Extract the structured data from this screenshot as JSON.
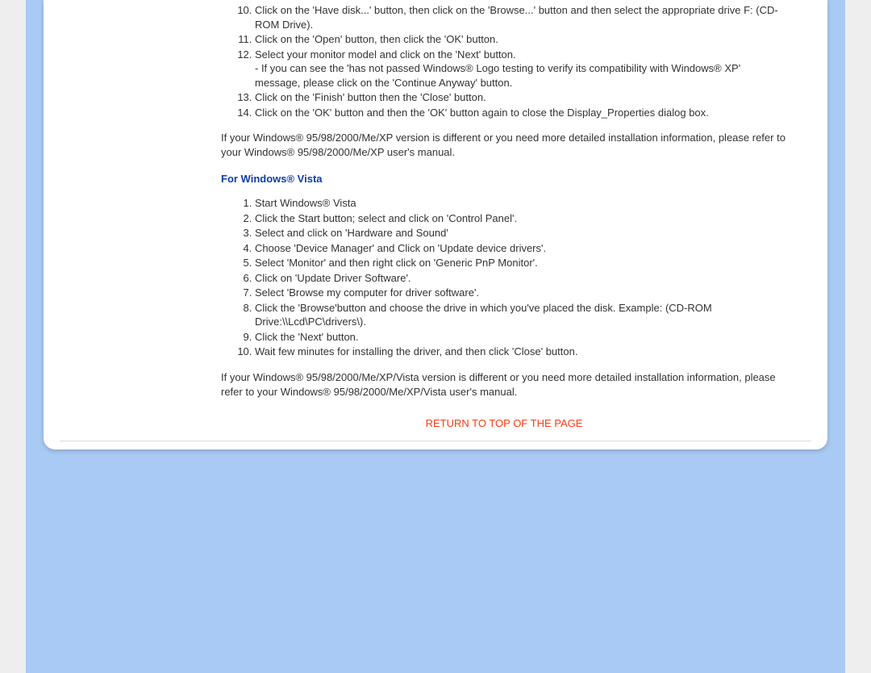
{
  "xp_list": {
    "start": 10,
    "items": [
      {
        "text": "Click on the 'Have disk...' button, then click on the 'Browse...' button and then select the appropriate drive F: (CD-ROM Drive)."
      },
      {
        "text": "Click on the 'Open' button, then click the 'OK' button."
      },
      {
        "text": "Select your monitor model and click on the 'Next' button.",
        "sub": "- If you can see the 'has not passed Windows® Logo testing to verify its compatibility with Windows® XP' message, please click on the 'Continue Anyway' button."
      },
      {
        "text": "Click on the 'Finish' button then the 'Close' button."
      },
      {
        "text": "Click on the 'OK' button and then the 'OK' button again to close the Display_Properties dialog box."
      }
    ]
  },
  "xp_footer": "If your Windows® 95/98/2000/Me/XP version is different or you need more detailed installation information, please refer to your Windows® 95/98/2000/Me/XP user's manual.",
  "vista_heading": "For Windows® Vista",
  "vista_list": {
    "start": 1,
    "items": [
      {
        "text": "Start Windows® Vista"
      },
      {
        "text": "Click the Start button; select and click on 'Control Panel'."
      },
      {
        "text": "Select and click on 'Hardware and Sound'"
      },
      {
        "text": "Choose 'Device Manager' and Click on 'Update device drivers'."
      },
      {
        "text": "Select 'Monitor' and then right click on 'Generic PnP Monitor'."
      },
      {
        "text": "Click on 'Update Driver Software'."
      },
      {
        "text": "Select 'Browse my computer for driver software'."
      },
      {
        "text": "Click the 'Browse'button and choose the drive in which you've placed the disk. Example: (CD-ROM Drive:\\\\Lcd\\PC\\drivers\\)."
      },
      {
        "text": "Click the 'Next' button."
      },
      {
        "text": "Wait few minutes for installing the driver, and then click 'Close' button."
      }
    ]
  },
  "vista_footer": "If your Windows® 95/98/2000/Me/XP/Vista version is different or you need more detailed installation information, please refer to your Windows® 95/98/2000/Me/XP/Vista user's manual.",
  "return_link": "RETURN TO TOP OF THE PAGE"
}
